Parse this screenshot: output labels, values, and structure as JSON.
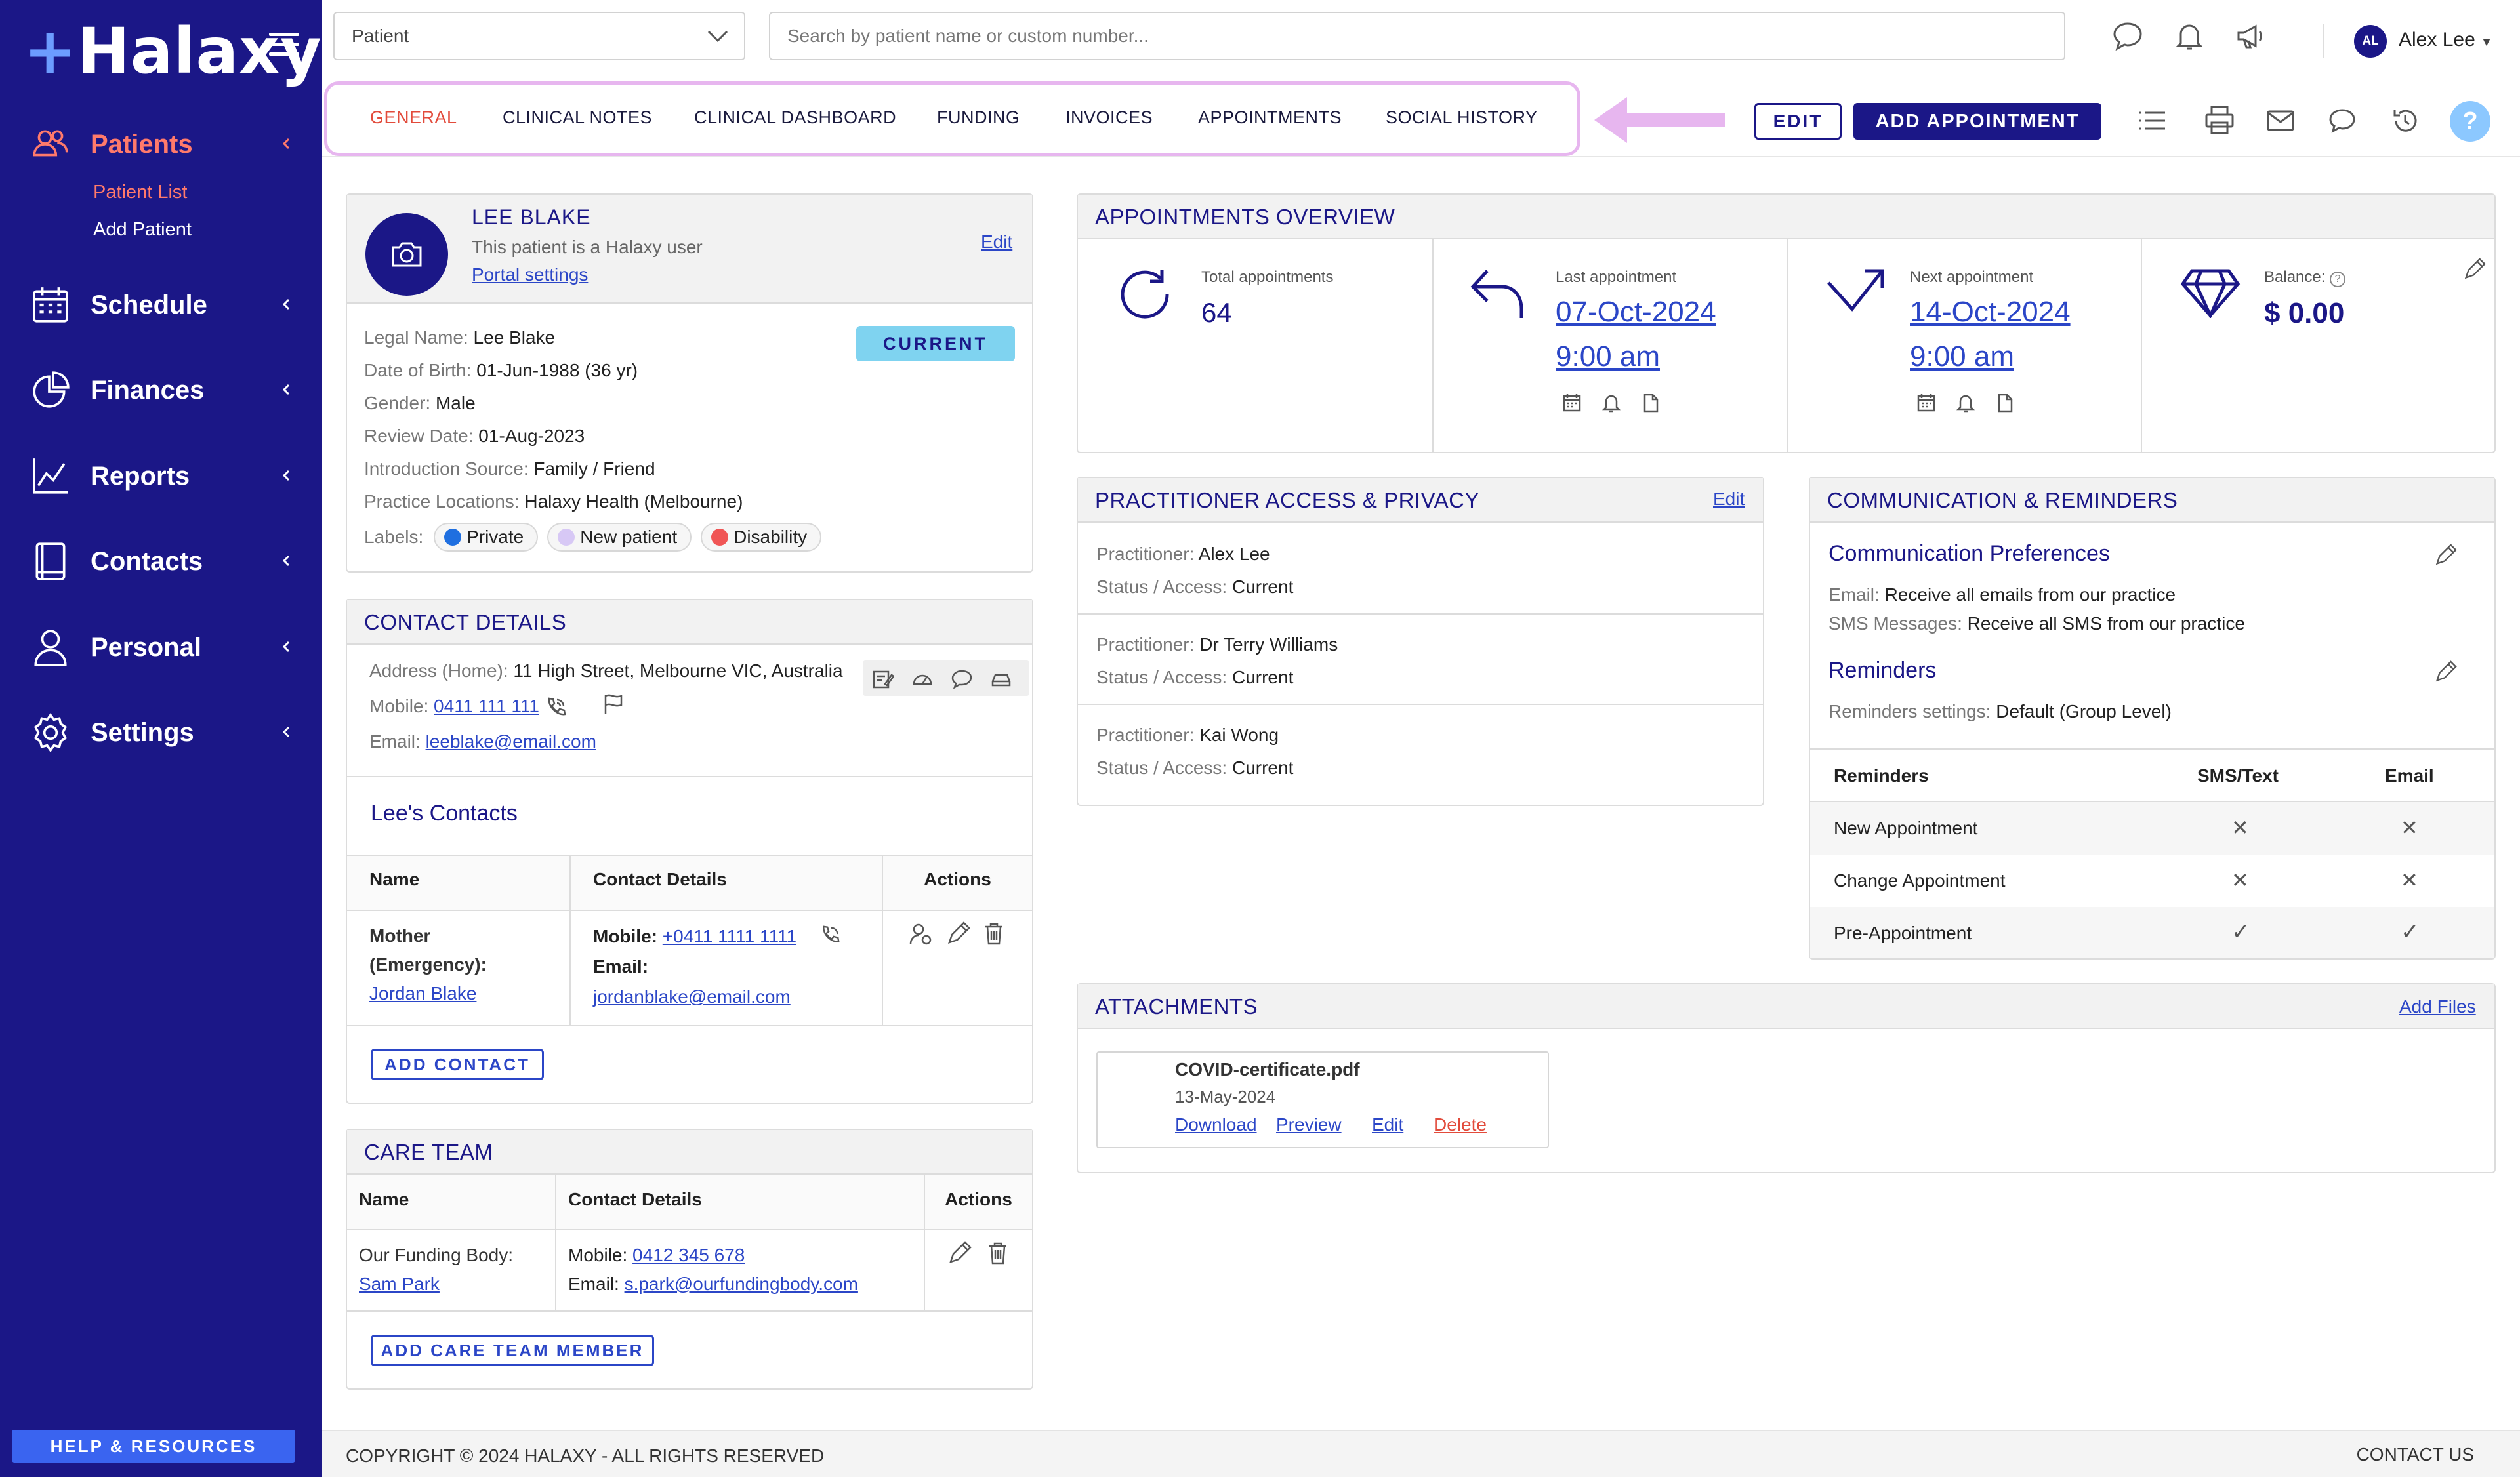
{
  "brand": {
    "name": "Halaxy"
  },
  "sidebar": {
    "items": [
      {
        "label": "Patients"
      },
      {
        "label": "Schedule"
      },
      {
        "label": "Finances"
      },
      {
        "label": "Reports"
      },
      {
        "label": "Contacts"
      },
      {
        "label": "Personal"
      },
      {
        "label": "Settings"
      }
    ],
    "sub_items": [
      "Patient List",
      "Add Patient"
    ],
    "help_label": "HELP & RESOURCES"
  },
  "topbar": {
    "select_value": "Patient",
    "search_placeholder": "Search by patient name or custom number...",
    "user_initials": "AL",
    "user_name": "Alex Lee"
  },
  "tabs": [
    "GENERAL",
    "CLINICAL NOTES",
    "CLINICAL DASHBOARD",
    "FUNDING",
    "INVOICES",
    "APPOINTMENTS",
    "SOCIAL HISTORY"
  ],
  "actions": {
    "edit_label": "EDIT",
    "add_appointment_label": "ADD APPOINTMENT",
    "help": "?"
  },
  "patient": {
    "name": "LEE BLAKE",
    "subtitle": "This patient is a Halaxy user",
    "portal_link": "Portal settings",
    "edit_link": "Edit",
    "status": "CURRENT",
    "fields": [
      {
        "label": "Legal Name:",
        "value": "Lee Blake"
      },
      {
        "label": "Date of Birth:",
        "value": "01-Jun-1988 (36 yr)"
      },
      {
        "label": "Gender:",
        "value": "Male"
      },
      {
        "label": "Review Date:",
        "value": "01-Aug-2023"
      },
      {
        "label": "Introduction Source:",
        "value": "Family / Friend"
      },
      {
        "label": "Practice Locations:",
        "value": "Halaxy Health (Melbourne)"
      }
    ],
    "labels_title": "Labels:",
    "labels": [
      {
        "text": "Private",
        "color": "#1f6fe0"
      },
      {
        "text": "New patient",
        "color": "#d7c8f5"
      },
      {
        "text": "Disability",
        "color": "#f05555"
      }
    ]
  },
  "contact_details": {
    "title": "CONTACT DETAILS",
    "address_label": "Address (Home):",
    "address": "11 High Street, Melbourne VIC, Australia",
    "mobile_label": "Mobile:",
    "mobile": "0411 111 111",
    "email_label": "Email:",
    "email": "leeblake@email.com",
    "contacts_title": "Lee's Contacts",
    "table_headers": [
      "Name",
      "Contact Details",
      "Actions"
    ],
    "rows": [
      {
        "relation": "Mother (Emergency):",
        "name": "Jordan Blake",
        "mobile_label": "Mobile:",
        "mobile": "+0411 1111 1111",
        "email_label": "Email:",
        "email": "jordanblake@email.com"
      }
    ],
    "add_button": "ADD CONTACT"
  },
  "care_team": {
    "title": "CARE TEAM",
    "table_headers": [
      "Name",
      "Contact Details",
      "Actions"
    ],
    "rows": [
      {
        "role": "Our Funding Body:",
        "name": "Sam Park",
        "mobile_label": "Mobile:",
        "mobile": "0412 345 678",
        "email_label": "Email:",
        "email": "s.park@ourfundingbody.com"
      }
    ],
    "add_button": "ADD CARE TEAM MEMBER"
  },
  "appointments_overview": {
    "title": "APPOINTMENTS OVERVIEW",
    "total_label": "Total appointments",
    "total": "64",
    "last_label": "Last appointment",
    "last_date": "07-Oct-2024",
    "last_time": "9:00 am",
    "next_label": "Next appointment",
    "next_date": "14-Oct-2024",
    "next_time": "9:00 am",
    "balance_label": "Balance:",
    "balance": "$ 0.00"
  },
  "practitioner_access": {
    "title": "PRACTITIONER ACCESS & PRIVACY",
    "edit_link": "Edit",
    "practitioner_label": "Practitioner:",
    "status_label": "Status / Access:",
    "entries": [
      {
        "name": "Alex Lee",
        "status": "Current"
      },
      {
        "name": "Dr Terry Williams",
        "status": "Current"
      },
      {
        "name": "Kai Wong",
        "status": "Current"
      }
    ]
  },
  "communication": {
    "title": "COMMUNICATION & REMINDERS",
    "prefs_title": "Communication Preferences",
    "email_label": "Email:",
    "email_value": "Receive all emails from our practice",
    "sms_label": "SMS Messages:",
    "sms_value": "Receive all SMS from our practice",
    "reminders_title": "Reminders",
    "reminders_settings_label": "Reminders settings:",
    "reminders_settings_value": "Default (Group Level)",
    "table_headers": [
      "Reminders",
      "SMS/Text",
      "Email"
    ],
    "rows": [
      {
        "name": "New Appointment",
        "sms": "✕",
        "email": "✕"
      },
      {
        "name": "Change Appointment",
        "sms": "✕",
        "email": "✕"
      },
      {
        "name": "Pre-Appointment",
        "sms": "✓",
        "email": "✓"
      }
    ]
  },
  "attachments": {
    "title": "ATTACHMENTS",
    "add_link": "Add Files",
    "file": {
      "name": "COVID-certificate.pdf",
      "date": "13-May-2024",
      "download": "Download",
      "preview": "Preview",
      "edit": "Edit",
      "delete": "Delete"
    }
  },
  "footer": {
    "copyright": "COPYRIGHT © 2024 HALAXY - ALL RIGHTS RESERVED",
    "contact": "CONTACT US"
  }
}
